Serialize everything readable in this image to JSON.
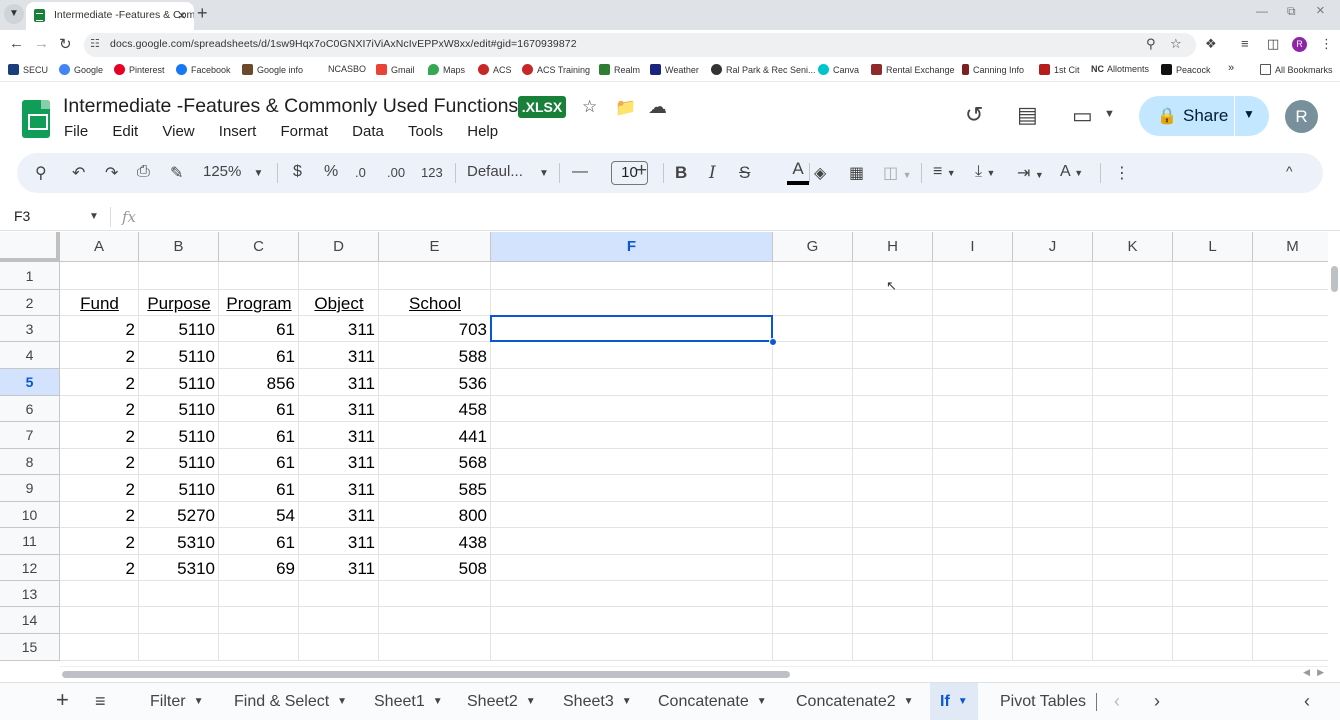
{
  "browser": {
    "tab_title": "Intermediate -Features & Commonly Used Functions - Google Sheets",
    "url": "docs.google.com/spreadsheets/d/1sw9Hqx7oC0GNXI7iViAxNcIvEPPxW8xx/edit#gid=1670939872",
    "bookmarks": [
      "SECU",
      "Google",
      "Pinterest",
      "Facebook",
      "Google info",
      "NCASBO",
      "Gmail",
      "Maps",
      "ACS",
      "ACS Training",
      "Realm",
      "Weather",
      "Ral Park & Rec Seni...",
      "Canva",
      "Rental Exchange",
      "Canning Info",
      "1st Cit",
      "Allotments",
      "Peacock"
    ],
    "all_bookmarks": "All Bookmarks",
    "profile_initial": "R"
  },
  "doc": {
    "title": "Intermediate -Features & Commonly Used Functions",
    "badge": ".XLSX",
    "menu": [
      "File",
      "Edit",
      "View",
      "Insert",
      "Format",
      "Data",
      "Tools",
      "Help"
    ],
    "share_label": "Share",
    "avatar_initial": "R"
  },
  "toolbar": {
    "zoom": "125%",
    "currency": "$",
    "percent": "%",
    "dec_decrease": ".0",
    "dec_increase": ".00",
    "number_format": "123",
    "font": "Defaul...",
    "font_size": "10"
  },
  "formula_bar": {
    "name_box": "F3",
    "fx": "fx",
    "value": ""
  },
  "grid": {
    "columns": [
      "A",
      "B",
      "C",
      "D",
      "E",
      "F",
      "G",
      "H",
      "I",
      "J",
      "K",
      "L",
      "M"
    ],
    "selected_column": "F",
    "rows": [
      "1",
      "2",
      "3",
      "4",
      "5",
      "6",
      "7",
      "8",
      "9",
      "10",
      "11",
      "12",
      "13",
      "14",
      "15"
    ],
    "highlighted_row": "5",
    "selected_cell": "F3",
    "headers": [
      "Fund",
      "Purpose",
      "Program",
      "Object",
      "School"
    ],
    "data": [
      [
        "2",
        "5110",
        "61",
        "311",
        "703"
      ],
      [
        "2",
        "5110",
        "61",
        "311",
        "588"
      ],
      [
        "2",
        "5110",
        "856",
        "311",
        "536"
      ],
      [
        "2",
        "5110",
        "61",
        "311",
        "458"
      ],
      [
        "2",
        "5110",
        "61",
        "311",
        "441"
      ],
      [
        "2",
        "5110",
        "61",
        "311",
        "568"
      ],
      [
        "2",
        "5110",
        "61",
        "311",
        "585"
      ],
      [
        "2",
        "5270",
        "54",
        "311",
        "800"
      ],
      [
        "2",
        "5310",
        "61",
        "311",
        "438"
      ],
      [
        "2",
        "5310",
        "69",
        "311",
        "508"
      ]
    ]
  },
  "sheets": {
    "tabs": [
      "Filter",
      "Find & Select",
      "Sheet1",
      "Sheet2",
      "Sheet3",
      "Concatenate",
      "Concatenate2",
      "If",
      "Pivot Tables"
    ],
    "active": "If"
  },
  "colors": {
    "accent": "#0b57d0",
    "selection_header": "#d3e3fd",
    "share_button": "#c2e7ff",
    "sheets_green": "#0f9d58",
    "xlsx_badge": "#188038"
  }
}
